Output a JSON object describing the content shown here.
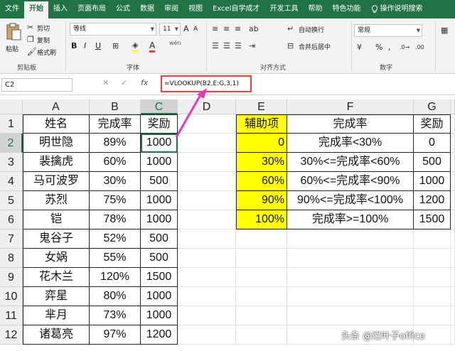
{
  "ribbon_tabs": [
    "文件",
    "开始",
    "插入",
    "页面布局",
    "公式",
    "数据",
    "审阅",
    "视图",
    "Excel自学成才",
    "开发工具",
    "帮助",
    "特色功能"
  ],
  "active_tab": 1,
  "help_label": "操作说明搜索",
  "ribbon": {
    "clipboard": {
      "paste": "粘贴",
      "cut": "剪切",
      "copy": "复制",
      "format_painter": "格式刷",
      "group": "剪贴板"
    },
    "font": {
      "name": "等线",
      "size": "11",
      "bold": "B",
      "italic": "I",
      "underline": "U",
      "grow": "A",
      "shrink": "A",
      "wen": "wén",
      "group": "字体"
    },
    "alignment": {
      "wrap": "自动换行",
      "merge": "合并后居中",
      "group": "对齐方式"
    },
    "number": {
      "format": "常规",
      "percent": "%",
      "comma": ",",
      "group": "数字"
    }
  },
  "name_box": "C2",
  "formula": "=VLOOKUP(B2,E:G,3,1)",
  "columns": [
    "A",
    "B",
    "C",
    "D",
    "E",
    "F",
    "G"
  ],
  "rows": [
    "1",
    "2",
    "3",
    "4",
    "5",
    "6",
    "7",
    "8",
    "9",
    "10",
    "11",
    "12"
  ],
  "left_table": {
    "headers": [
      "姓名",
      "完成率",
      "奖励"
    ],
    "rows": [
      [
        "明世隐",
        "89%",
        "1000"
      ],
      [
        "裴擒虎",
        "60%",
        "1000"
      ],
      [
        "马可波罗",
        "30%",
        "500"
      ],
      [
        "苏烈",
        "75%",
        "1000"
      ],
      [
        "铠",
        "78%",
        "1000"
      ],
      [
        "鬼谷子",
        "52%",
        "500"
      ],
      [
        "女娲",
        "55%",
        "500"
      ],
      [
        "花木兰",
        "120%",
        "1500"
      ],
      [
        "弈星",
        "80%",
        "1000"
      ],
      [
        "芈月",
        "73%",
        "1000"
      ],
      [
        "诸葛亮",
        "97%",
        "1200"
      ]
    ]
  },
  "right_table": {
    "headers": [
      "辅助项",
      "完成率",
      "奖励"
    ],
    "rows": [
      [
        "0",
        "完成率<30%",
        "0"
      ],
      [
        "30%",
        "30%<=完成率<60%",
        "500"
      ],
      [
        "60%",
        "60%<=完成率<90%",
        "1000"
      ],
      [
        "90%",
        "90%<=完成率<100%",
        "1200"
      ],
      [
        "100%",
        "完成率>=100%",
        "1500"
      ]
    ]
  },
  "watermark": "头条 @烂叶子office",
  "colors": {
    "excel_green": "#217346",
    "highlight_yellow": "#ffff00",
    "callout_red": "#e8403a",
    "arrow_magenta": "#e535c8"
  }
}
